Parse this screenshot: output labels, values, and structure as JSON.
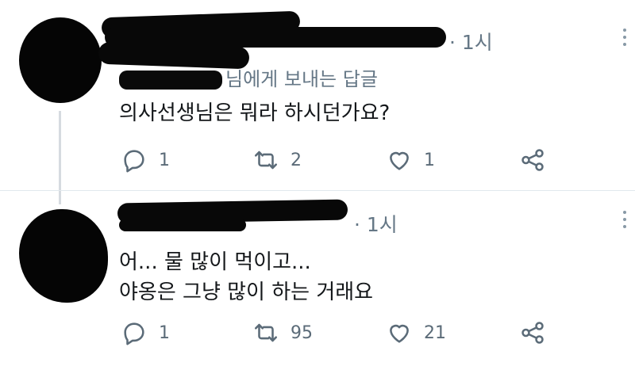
{
  "tweets": [
    {
      "time": "· 1시",
      "reply_context": "님에게 보내는 답글",
      "text": "의사선생님은 뭐라 하시던가요?",
      "replies": "1",
      "retweets": "2",
      "likes": "1"
    },
    {
      "time": "· 1시",
      "text_lines": [
        "어... 물 많이 먹이고...",
        "야옹은 그냥 많이 하는 거래요"
      ],
      "replies": "1",
      "retweets": "95",
      "likes": "21"
    }
  ],
  "icons": {
    "reply": "reply-icon",
    "retweet": "retweet-icon",
    "like": "heart-icon",
    "share": "share-icon",
    "more": "more-options-icon"
  },
  "colors": {
    "icon": "#5b6b78",
    "meta": "#657786",
    "text": "#14171a",
    "thread_line": "#d6dbe0"
  }
}
